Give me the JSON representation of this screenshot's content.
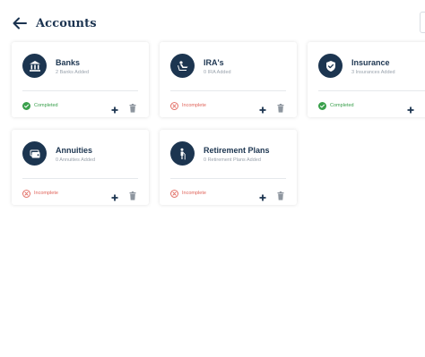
{
  "header": {
    "title": "Accounts"
  },
  "icons": {
    "back": "arrow-left-icon",
    "add": "plus-icon",
    "delete": "trash-icon",
    "completed": "check-circle-icon",
    "incomplete": "x-circle-icon"
  },
  "colors": {
    "primary": "#1c3550",
    "completed": "#3aa04c",
    "incomplete": "#e0645a",
    "muted": "#9aa3ad"
  },
  "cards": [
    {
      "title": "Banks",
      "subtitle": "2 Banks Added",
      "status": "Completed",
      "icon": "bank-icon"
    },
    {
      "title": "IRA's",
      "subtitle": "0 IRA Added",
      "status": "Incomplete",
      "icon": "ira-icon"
    },
    {
      "title": "Insurance",
      "subtitle": "3 Insurances Added",
      "status": "Completed",
      "icon": "shield-check-icon"
    },
    {
      "title": "Annuities",
      "subtitle": "0 Annuities Added",
      "status": "Incomplete",
      "icon": "wallet-icon"
    },
    {
      "title": "Retirement Plans",
      "subtitle": "0 Retirement Plans Added",
      "status": "Incomplete",
      "icon": "person-cane-icon"
    }
  ]
}
